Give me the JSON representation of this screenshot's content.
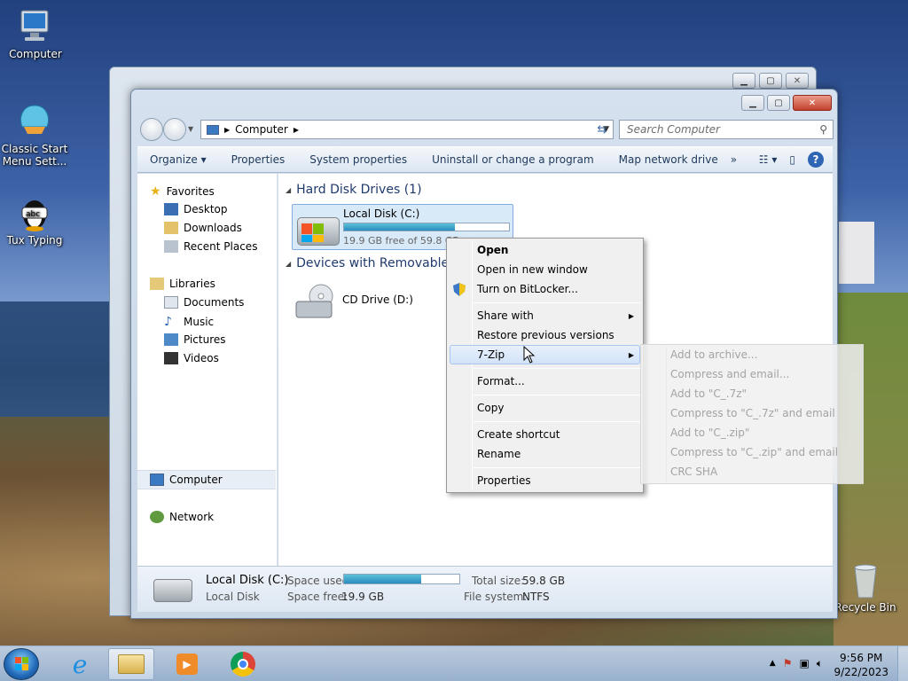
{
  "desktop": {
    "icons": [
      {
        "label": "Computer"
      },
      {
        "label": "Classic Start Menu Sett..."
      },
      {
        "label": "Tux Typing"
      },
      {
        "label": "Recycle Bin"
      }
    ]
  },
  "window": {
    "address": {
      "crumb": "Computer"
    },
    "search_placeholder": "Search Computer",
    "toolbar": {
      "organize": "Organize",
      "properties": "Properties",
      "system_properties": "System properties",
      "uninstall": "Uninstall or change a program",
      "map_drive": "Map network drive",
      "more": "»"
    },
    "nav": {
      "favorites": "Favorites",
      "desktop": "Desktop",
      "downloads": "Downloads",
      "recent": "Recent Places",
      "libraries": "Libraries",
      "documents": "Documents",
      "music": "Music",
      "pictures": "Pictures",
      "videos": "Videos",
      "computer": "Computer",
      "network": "Network"
    },
    "groups": {
      "hdd": "Hard Disk Drives (1)",
      "removable": "Devices with Removable"
    },
    "drive_c": {
      "name": "Local Disk (C:)",
      "free_text": "19.9 GB free of 59.8 GB",
      "used_fraction": 0.67
    },
    "drive_d": {
      "name": "CD Drive (D:)"
    },
    "details": {
      "title": "Local Disk (C:)",
      "type": "Local Disk",
      "space_used_label": "Space used:",
      "space_free_label": "Space free:",
      "space_free_value": "19.9 GB",
      "total_label": "Total size:",
      "total_value": "59.8 GB",
      "fs_label": "File system:",
      "fs_value": "NTFS"
    }
  },
  "context_menu": {
    "items": [
      {
        "label": "Open"
      },
      {
        "label": "Open in new window"
      },
      {
        "label": "Turn on BitLocker..."
      },
      {
        "label": "Share with"
      },
      {
        "label": "Restore previous versions"
      },
      {
        "label": "7-Zip"
      },
      {
        "label": "Format..."
      },
      {
        "label": "Copy"
      },
      {
        "label": "Create shortcut"
      },
      {
        "label": "Rename"
      },
      {
        "label": "Properties"
      }
    ]
  },
  "zip_submenu": {
    "items": [
      {
        "label": "Add to archive..."
      },
      {
        "label": "Compress and email..."
      },
      {
        "label": "Add to \"C_.7z\""
      },
      {
        "label": "Compress to \"C_.7z\" and email"
      },
      {
        "label": "Add to \"C_.zip\""
      },
      {
        "label": "Compress to \"C_.zip\" and email"
      },
      {
        "label": "CRC SHA"
      }
    ]
  },
  "taskbar": {
    "time": "9:56 PM",
    "date": "9/22/2023"
  }
}
